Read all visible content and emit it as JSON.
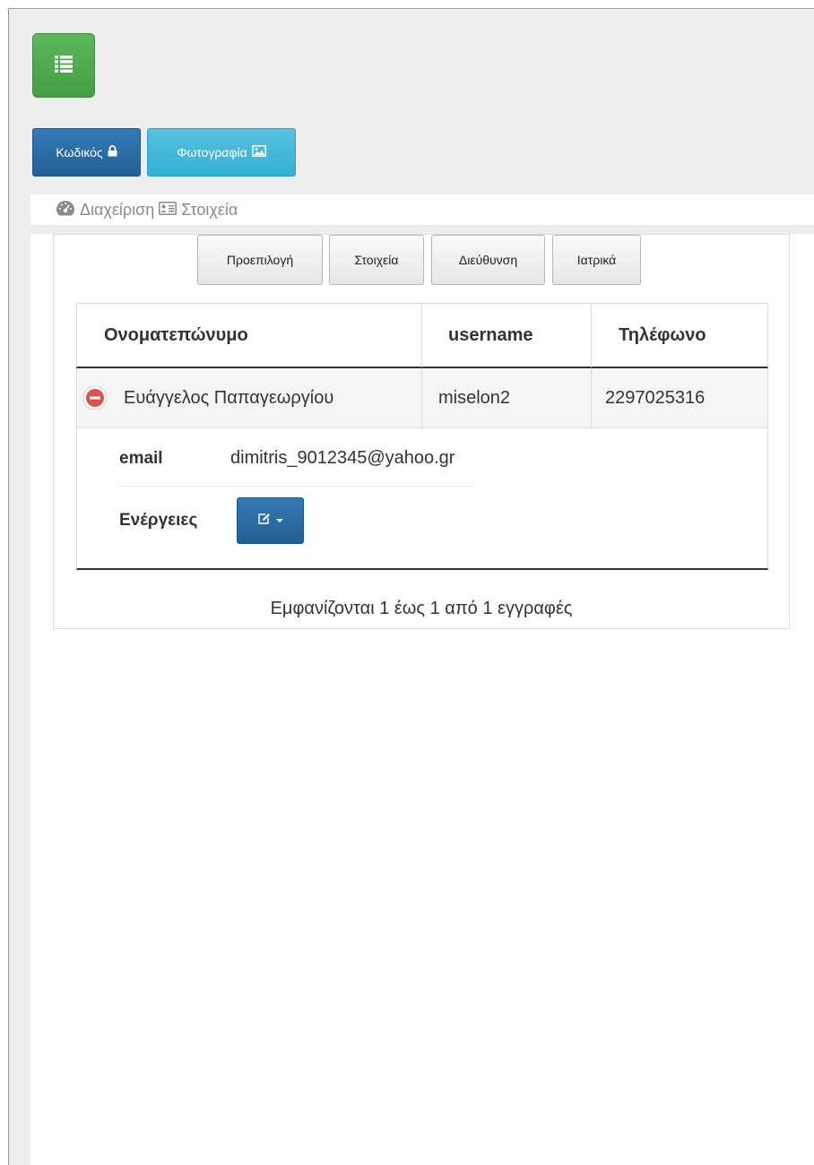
{
  "toolbar": {
    "menu_icon": "list-icon",
    "password_label": "Κωδικός",
    "password_icon": "lock-icon",
    "photo_label": "Φωτογραφία",
    "photo_icon": "image-icon"
  },
  "breadcrumb": {
    "admin_icon": "dashboard-icon",
    "admin_label": "Διαχείριση",
    "details_icon": "id-card-icon",
    "details_label": "Στοιχεία"
  },
  "tabs": [
    {
      "label": "Προεπιλογή"
    },
    {
      "label": "Στοιχεία"
    },
    {
      "label": "Διεύθυνση"
    },
    {
      "label": "Ιατρικά"
    }
  ],
  "table": {
    "columns": [
      "Ονοματεπώνυμο",
      "username",
      "Τηλέφωνο"
    ],
    "rows": [
      {
        "name": "Ευάγγελος Παπαγεωργίου",
        "username": "miselon2",
        "phone": "2297025316"
      }
    ],
    "detail": {
      "email_label": "email",
      "email_value": "dimitris_9012345@yahoo.gr",
      "actions_label": "Ενέργειες",
      "actions_icon": "edit-icon"
    }
  },
  "info": "Εμφανίζονται 1 έως 1 από 1 εγγραφές",
  "colors": {
    "success": "#5cb85c",
    "primary": "#337ab7",
    "info": "#5bc0de",
    "danger": "#d9534f",
    "background": "#eeeeee"
  }
}
